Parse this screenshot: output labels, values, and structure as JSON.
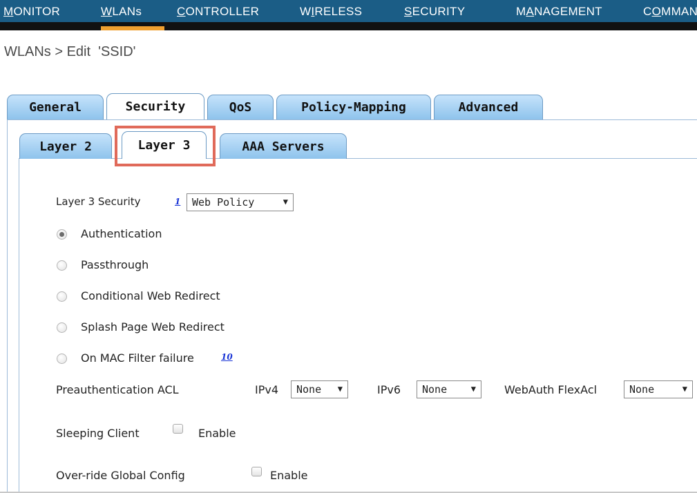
{
  "nav": {
    "items": [
      {
        "pre": "",
        "u": "M",
        "post": "ONITOR"
      },
      {
        "pre": "",
        "u": "W",
        "post": "LANs"
      },
      {
        "pre": "",
        "u": "C",
        "post": "ONTROLLER"
      },
      {
        "pre": "W",
        "u": "I",
        "post": "RELESS"
      },
      {
        "pre": "",
        "u": "S",
        "post": "ECURITY"
      },
      {
        "pre": "M",
        "u": "A",
        "post": "NAGEMENT"
      },
      {
        "pre": "C",
        "u": "O",
        "post": "MMANDS"
      }
    ],
    "active_color": "#f0a030"
  },
  "page": {
    "title": "WLANs > Edit  'SSID'"
  },
  "tabs": [
    "General",
    "Security",
    "QoS",
    "Policy-Mapping",
    "Advanced"
  ],
  "active_tab": "Security",
  "subtabs": [
    "Layer 2",
    "Layer 3",
    "AAA Servers"
  ],
  "active_subtab": "Layer 3",
  "highlight_color": "#e06a5a",
  "form": {
    "layer3_label": "Layer 3 Security",
    "layer3_help": "1",
    "layer3_value": "Web Policy",
    "radios": [
      {
        "label": "Authentication",
        "checked": true
      },
      {
        "label": "Passthrough",
        "checked": false
      },
      {
        "label": "Conditional Web Redirect",
        "checked": false
      },
      {
        "label": "Splash Page Web Redirect",
        "checked": false
      },
      {
        "label": "On MAC Filter failure",
        "checked": false
      }
    ],
    "mac_help": "10",
    "preauth_label": "Preauthentication ACL",
    "ipv4_label": "IPv4",
    "ipv4_value": "None",
    "ipv6_label": "IPv6",
    "ipv6_value": "None",
    "flexacl_label": "WebAuth FlexAcl",
    "flexacl_value": "None",
    "sleeping_label": "Sleeping Client",
    "sleeping_enable": "Enable",
    "override_label": "Over-ride Global Config",
    "override_enable": "Enable"
  }
}
